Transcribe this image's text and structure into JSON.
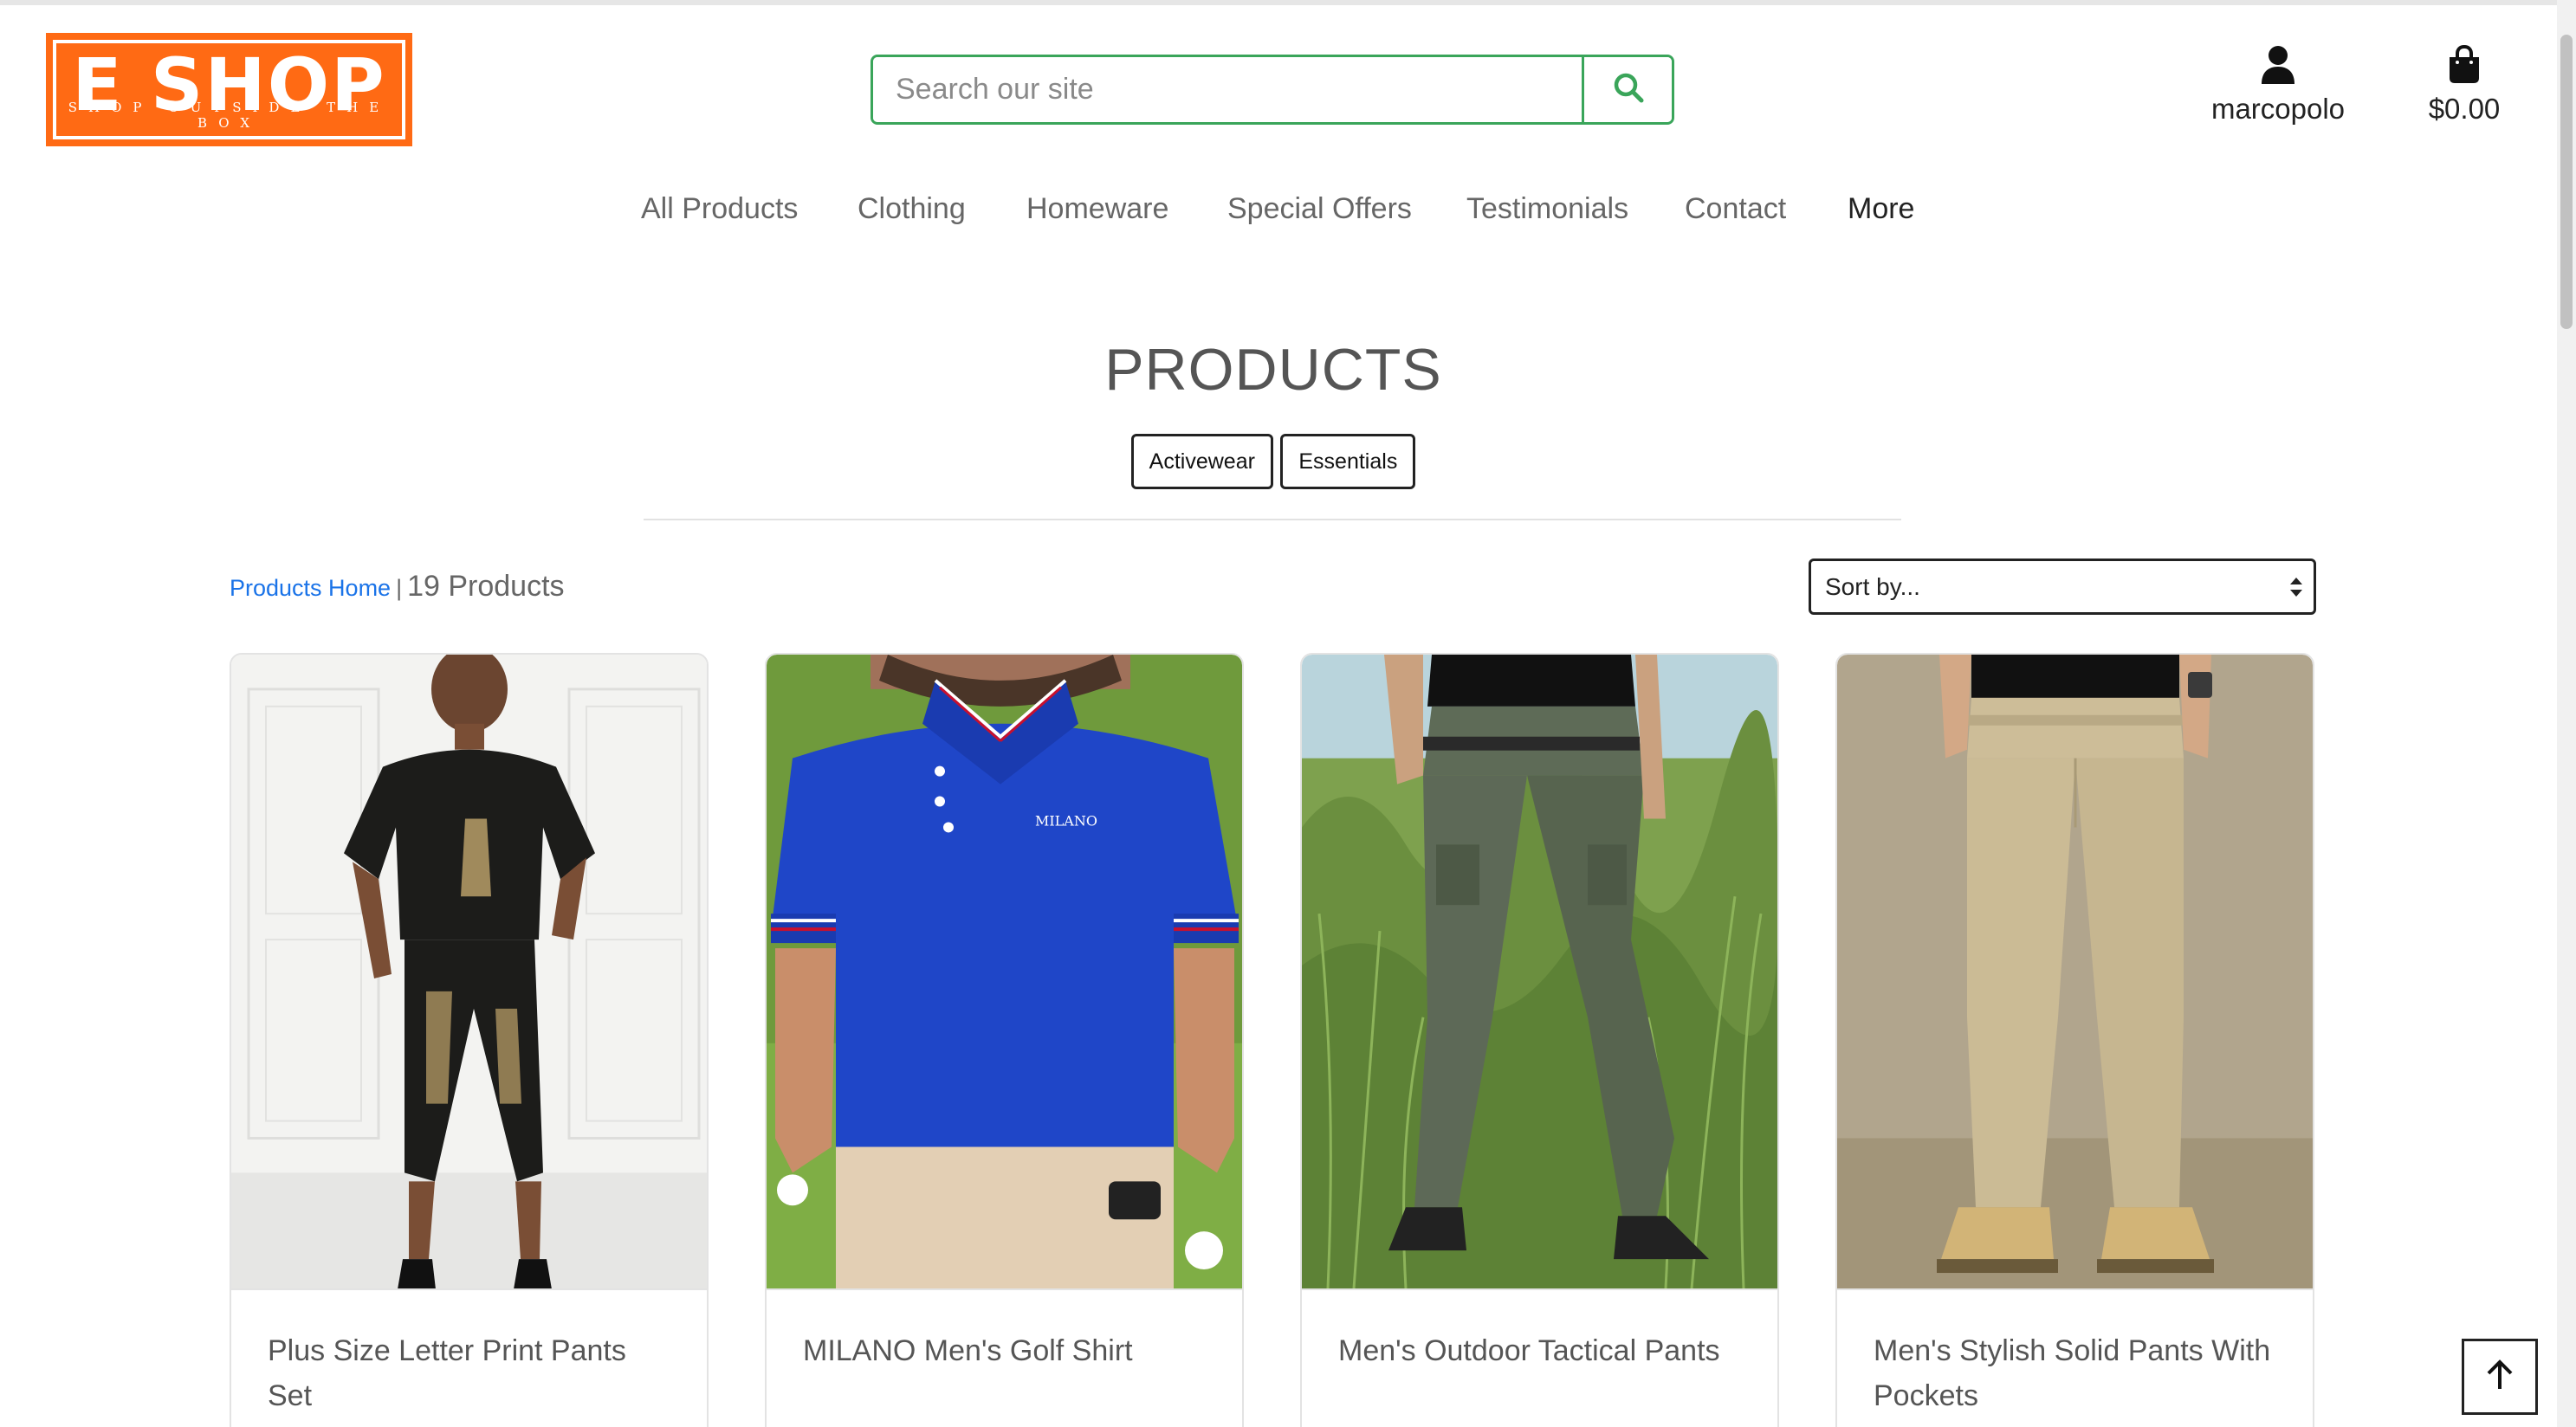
{
  "brand": {
    "name": "E SHOP",
    "tagline": "SHOP OUTSIDE THE BOX",
    "accent": "#ff6a14"
  },
  "search": {
    "placeholder": "Search our site",
    "button_icon": "search-icon",
    "accent": "#3aa55a"
  },
  "header": {
    "account": {
      "icon": "user-icon",
      "label": "marcopolo"
    },
    "bag": {
      "icon": "shopping-bag-icon",
      "total": "$0.00"
    }
  },
  "nav": {
    "items": [
      {
        "label": "All Products"
      },
      {
        "label": "Clothing"
      },
      {
        "label": "Homeware"
      },
      {
        "label": "Special Offers"
      },
      {
        "label": "Testimonials"
      },
      {
        "label": "Contact"
      },
      {
        "label": "More"
      }
    ]
  },
  "page": {
    "title": "PRODUCTS",
    "categories": [
      "Activewear",
      "Essentials"
    ],
    "breadcrumb_link": "Products Home",
    "separator": "|",
    "count_text": "19 Products"
  },
  "sort": {
    "selected": "Sort by...",
    "icon": "sort-arrows-icon"
  },
  "products": [
    {
      "name": "Plus Size Letter Print Pants Set"
    },
    {
      "name": "MILANO Men's Golf Shirt",
      "image_text": "MILANO"
    },
    {
      "name": "Men's Outdoor Tactical Pants"
    },
    {
      "name": "Men's Stylish Solid Pants With Pockets"
    }
  ],
  "back_to_top": {
    "icon": "arrow-up-icon"
  }
}
